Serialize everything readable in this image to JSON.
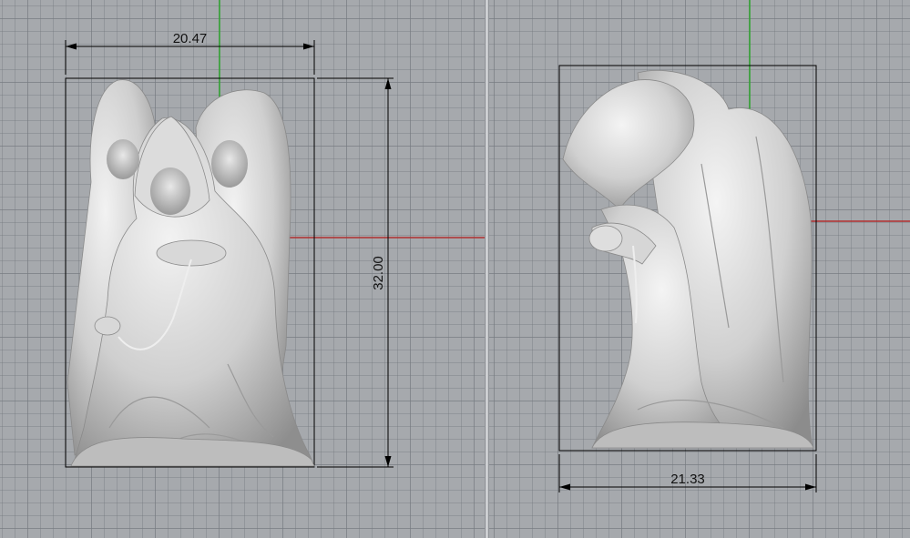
{
  "viewports": {
    "front": {
      "width_dimension": "20.47",
      "height_dimension": "32.00"
    },
    "side": {
      "width_dimension": "21.33"
    }
  },
  "colors": {
    "grid_background": "#a6a9ad",
    "grid_line": "#787c82",
    "y_axis": "#2fa52f",
    "x_axis": "#b03030",
    "model": "#cfcfcf",
    "dimension": "#000000"
  },
  "icons": {
    "model": "hooded-figures-sculpture"
  }
}
